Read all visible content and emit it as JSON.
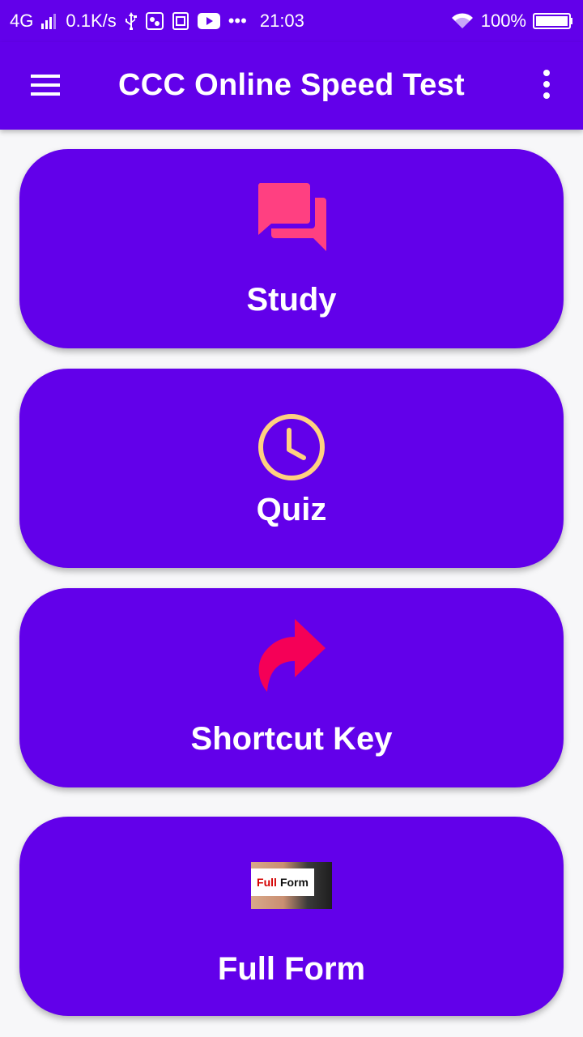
{
  "status_bar": {
    "network": "4G",
    "speed": "0.1K/s",
    "more": "•••",
    "time": "21:03",
    "battery": "100%"
  },
  "app_bar": {
    "title": "CCC Online Speed Test"
  },
  "cards": {
    "study": {
      "label": "Study",
      "icon": "forum-icon",
      "icon_color": "#ff4081"
    },
    "quiz": {
      "label": "Quiz",
      "icon": "clock-icon",
      "icon_color": "#ffd180"
    },
    "shortcut": {
      "label": "Shortcut Key",
      "icon": "share-arrow-icon",
      "icon_color": "#f50057"
    },
    "full_form": {
      "label": "Full Form",
      "icon": "full-form-image",
      "image_text": [
        "Full",
        "Form"
      ]
    }
  },
  "colors": {
    "primary": "#6200ea",
    "background": "#f7f7f9",
    "text": "#ffffff"
  }
}
